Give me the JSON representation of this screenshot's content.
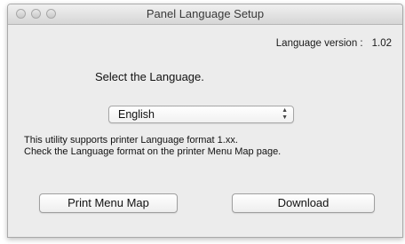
{
  "window": {
    "title": "Panel Language Setup"
  },
  "language_version": {
    "label": "Language version :",
    "value": "1.02"
  },
  "prompt": "Select the Language.",
  "language_select": {
    "selected": "English",
    "arrows": "▲▼"
  },
  "info": {
    "line1": "This utility supports printer Language format 1.xx.",
    "line2": "Check the Language format on the printer Menu Map page."
  },
  "buttons": {
    "print_menu_map": "Print Menu Map",
    "download": "Download"
  }
}
